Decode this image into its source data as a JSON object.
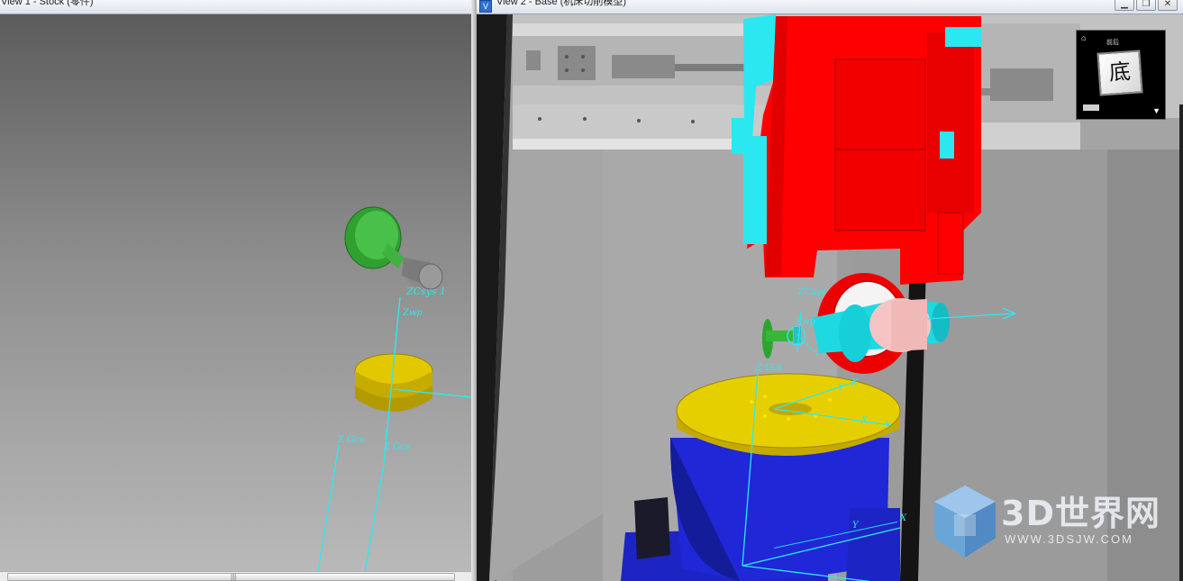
{
  "view1": {
    "title": "View 1 - Stock (零件)",
    "labels": {
      "zcsys1": "ZCsys 1",
      "zwp": "Zwp",
      "zgcs": "Z Gcs",
      "zgcs2": "Z Gcs"
    }
  },
  "view2": {
    "title": "View 2 - Base (机床切削模型)",
    "window_buttons": {
      "minimize": "▁",
      "restore": "❐",
      "close": "✕"
    },
    "labels": {
      "zcsys": "ZCsys",
      "zwp": "Zwp",
      "zgcs": "Z Gcs",
      "y1": "Y",
      "x1": "X",
      "x2": "X",
      "y2": "Y",
      "y3": "Y",
      "x3": "X"
    },
    "view_cube": {
      "face_label": "底",
      "top_label": "前后",
      "home": "⌂",
      "menu": "▼"
    }
  },
  "watermark": {
    "text": "3D世界网",
    "sub": "WWW.3DSJW.COM"
  },
  "colors": {
    "machine_red": "#ff0000",
    "cyan_parts": "#00e5e5",
    "stock_yellow": "#e6d000",
    "base_blue": "#1c28d8",
    "tool_green": "#2fa82f"
  }
}
